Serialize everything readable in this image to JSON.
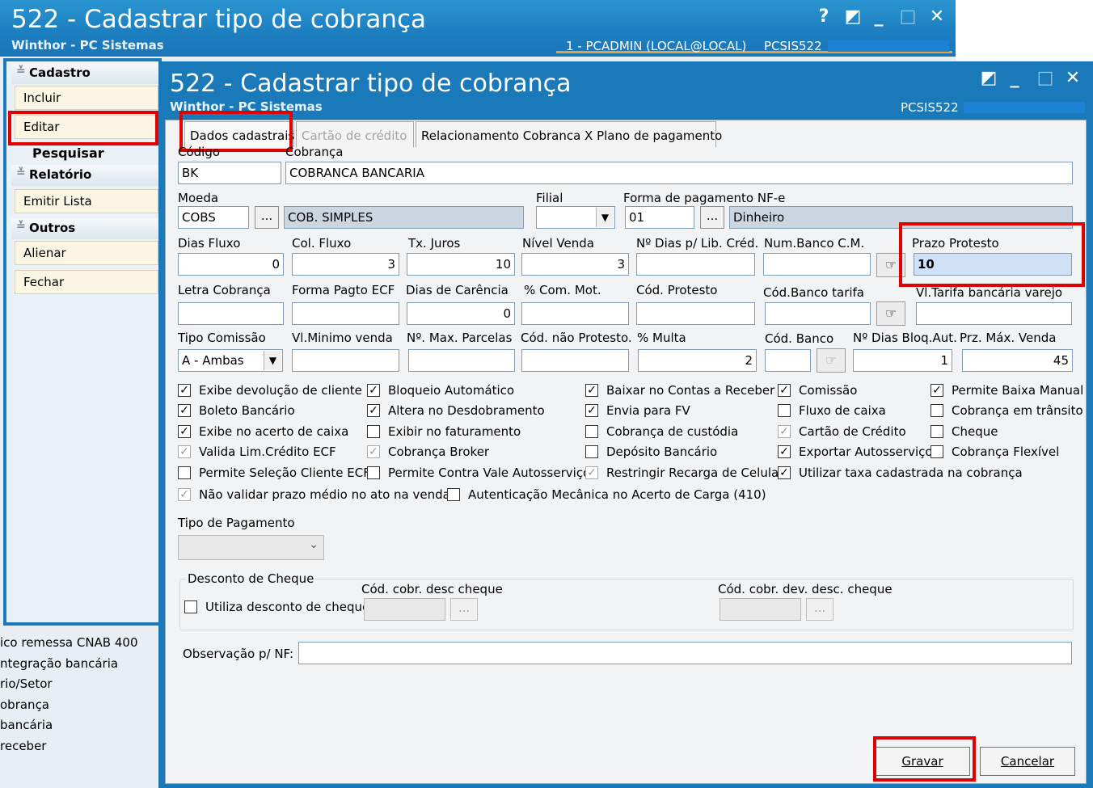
{
  "outer": {
    "title": "522 - Cadastrar tipo de cobrança",
    "subtitle": "Winthor - PC Sistemas",
    "user": "1 - PCADMIN (LOCAL@LOCAL)",
    "code": "PCSIS522",
    "controls": {
      "help": "?",
      "restore": "◩",
      "minimize": "_",
      "maximize": "□",
      "close": "✕"
    }
  },
  "menu": {
    "cadastro": "Cadastro",
    "incluir": "Incluir",
    "editar": "Editar",
    "pesquisar": "Pesquisar",
    "relatorio": "Relatório",
    "emitir_lista": "Emitir Lista",
    "outros": "Outros",
    "alienar": "Alienar",
    "fechar": "Fechar"
  },
  "bg_list": [
    "ico remessa CNAB 400",
    "ntegração bancária",
    "rio/Setor",
    "obrança",
    " bancária",
    "receber"
  ],
  "inner": {
    "title": "522 - Cadastrar tipo de cobrança",
    "subtitle": "Winthor - PC Sistemas",
    "code": "PCSIS522",
    "controls": {
      "restore": "◩",
      "minimize": "_",
      "maximize": "□",
      "close": "✕"
    }
  },
  "tabs": [
    "Dados cadastrais",
    "Cartão de crédito",
    "Relacionamento Cobranca X Plano de pagamento"
  ],
  "form": {
    "codigo_label": "Código",
    "codigo": "BK",
    "cobranca_label": "Cobrança",
    "cobranca": "COBRANCA BANCARIA",
    "moeda_label": "Moeda",
    "moeda": "COBS",
    "moeda_desc": "COB. SIMPLES",
    "filial_label": "Filial",
    "filial": "",
    "forma_nfe_label": "Forma de pagamento NF-e",
    "forma_nfe": "01",
    "forma_nfe_desc": "Dinheiro",
    "ellipsis": "...",
    "row3": {
      "labels": [
        "Dias Fluxo",
        "Col. Fluxo",
        "Tx. Juros",
        "Nível Venda",
        "Nº Dias p/ Lib. Créd.",
        "Num.Banco C.M.",
        "Prazo Protesto"
      ],
      "values": [
        "0",
        "3",
        "10",
        "3",
        "",
        "",
        "10"
      ]
    },
    "row4": {
      "labels": [
        "Letra Cobrança",
        "Forma Pagto ECF",
        "Dias de Carência",
        "% Com. Mot.",
        "Cód. Protesto",
        "Cód.Banco tarifa",
        "Vl.Tarifa bancária varejo"
      ],
      "values": [
        "",
        "",
        "0",
        "",
        "",
        "",
        ""
      ]
    },
    "row5": {
      "labels": [
        "Tipo Comissão",
        "Vl.Minimo venda",
        "Nº. Max. Parcelas",
        "Cód. não Protesto.",
        "% Multa",
        "Cód. Banco",
        "Nº Dias Bloq.Aut.",
        "Prz. Máx. Venda"
      ],
      "values": [
        "A - Ambas",
        "",
        "",
        "",
        "2",
        "",
        "1",
        "45"
      ]
    }
  },
  "checkboxes": {
    "c1": [
      "Exibe devolução de cliente",
      "Boleto Bancário",
      "Exibe no acerto de caixa",
      "Valida Lim.Crédito ECF",
      "Permite Seleção Cliente ECF",
      "Não validar prazo médio no ato na venda"
    ],
    "c2": [
      "Bloqueio Automático",
      "Altera no Desdobramento",
      "Exibir no faturamento",
      "Cobrança Broker",
      "Permite Contra Vale Autosserviço",
      "Autenticação Mecânica no Acerto de Carga (410)"
    ],
    "c3": [
      "Baixar no Contas a Receber",
      "Envia para FV",
      "Cobrança de custódia",
      "Depósito Bancário",
      "Restringir Recarga de Celular"
    ],
    "c4": [
      "Comissão",
      "Fluxo de caixa",
      "Cartão de Crédito",
      "Exportar Autosserviço",
      "Utilizar taxa cadastrada na cobrança"
    ],
    "c5": [
      "Permite Baixa Manual",
      "Cobrança em trânsito",
      "Cheque",
      "Cobrança Flexível"
    ],
    "checkmark": "✓"
  },
  "tipo_pagamento_label": "Tipo de Pagamento",
  "desconto": {
    "group_label": "Desconto de Cheque",
    "utiliza": "Utiliza desconto de cheque",
    "cod_desc": "Cód. cobr. desc cheque",
    "cod_dev": "Cód. cobr. dev. desc. cheque"
  },
  "observacao_label": "Observação p/ NF:",
  "buttons": {
    "gravar": "Gravar",
    "cancelar": "Cancelar"
  },
  "colors": {
    "titlebar": "#1a7ab9",
    "highlight": "#e10000",
    "accent": "#e3a23b"
  }
}
